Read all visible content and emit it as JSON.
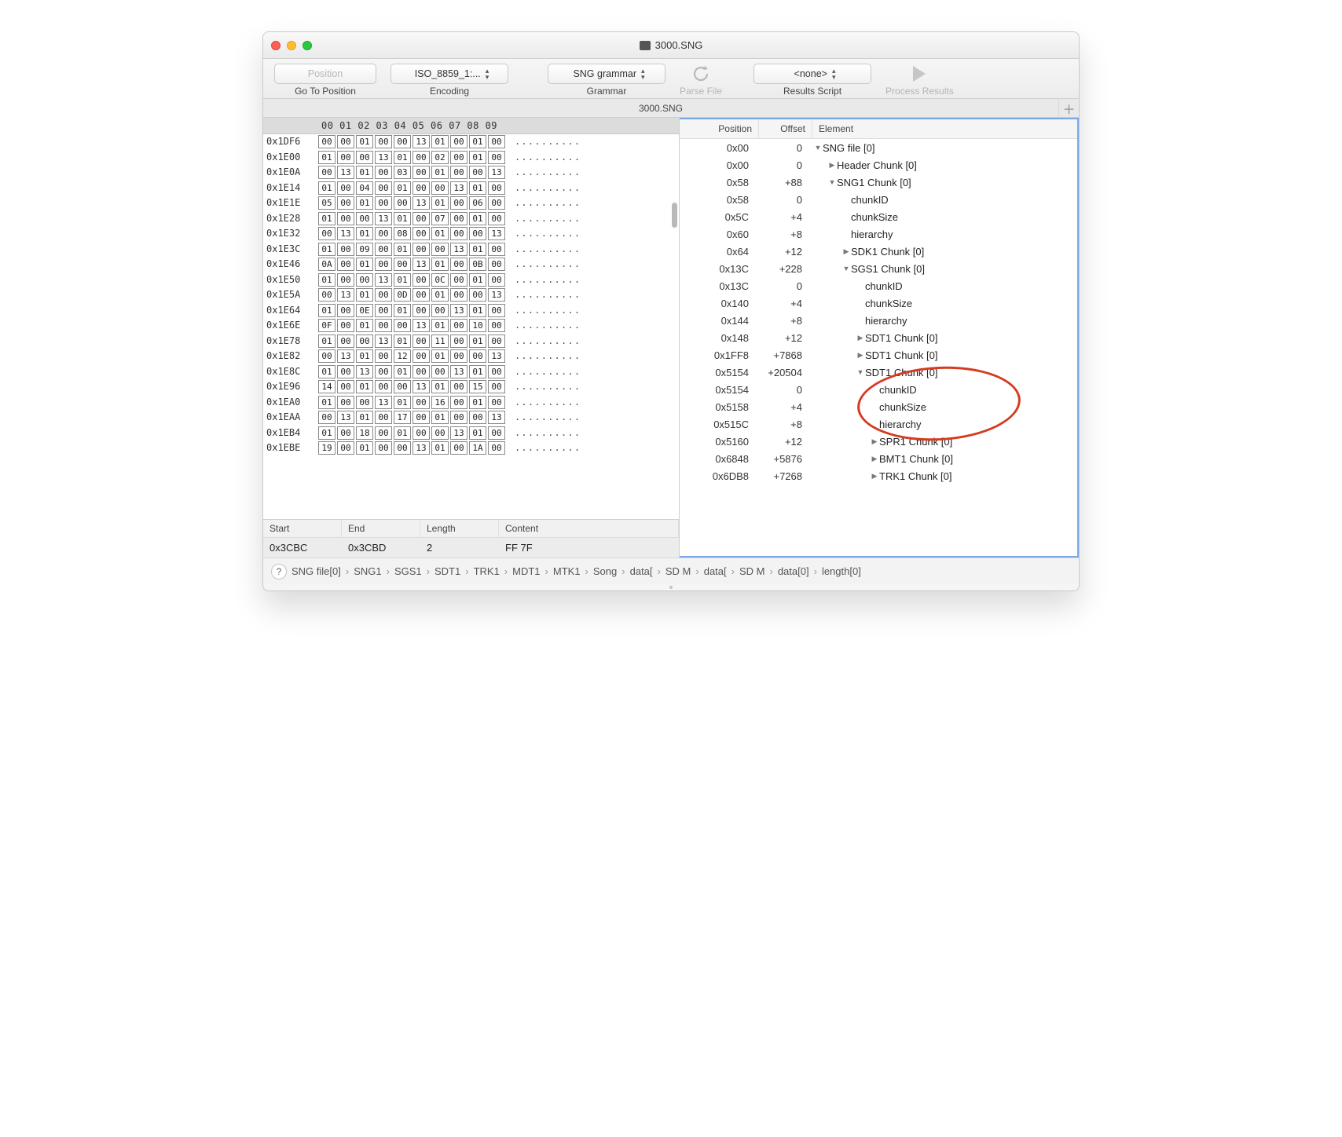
{
  "window": {
    "title": "3000.SNG"
  },
  "toolbar": {
    "position_btn": "Position",
    "go_to_label": "Go To Position",
    "encoding_value": "ISO_8859_1:...",
    "encoding_label": "Encoding",
    "grammar_value": "SNG grammar",
    "grammar_label": "Grammar",
    "parse_label": "Parse File",
    "script_value": "<none>",
    "script_label": "Results Script",
    "process_label": "Process Results"
  },
  "tab": {
    "label": "3000.SNG"
  },
  "hex": {
    "header": "00 01 02 03 04 05 06 07 08 09",
    "rows": [
      {
        "addr": "0x1DF6",
        "bytes": [
          "00",
          "00",
          "01",
          "00",
          "00",
          "13",
          "01",
          "00",
          "01",
          "00"
        ],
        "ascii": ".........."
      },
      {
        "addr": "0x1E00",
        "bytes": [
          "01",
          "00",
          "00",
          "13",
          "01",
          "00",
          "02",
          "00",
          "01",
          "00"
        ],
        "ascii": ".........."
      },
      {
        "addr": "0x1E0A",
        "bytes": [
          "00",
          "13",
          "01",
          "00",
          "03",
          "00",
          "01",
          "00",
          "00",
          "13"
        ],
        "ascii": ".........."
      },
      {
        "addr": "0x1E14",
        "bytes": [
          "01",
          "00",
          "04",
          "00",
          "01",
          "00",
          "00",
          "13",
          "01",
          "00"
        ],
        "ascii": ".........."
      },
      {
        "addr": "0x1E1E",
        "bytes": [
          "05",
          "00",
          "01",
          "00",
          "00",
          "13",
          "01",
          "00",
          "06",
          "00"
        ],
        "ascii": ".........."
      },
      {
        "addr": "0x1E28",
        "bytes": [
          "01",
          "00",
          "00",
          "13",
          "01",
          "00",
          "07",
          "00",
          "01",
          "00"
        ],
        "ascii": ".........."
      },
      {
        "addr": "0x1E32",
        "bytes": [
          "00",
          "13",
          "01",
          "00",
          "08",
          "00",
          "01",
          "00",
          "00",
          "13"
        ],
        "ascii": ".........."
      },
      {
        "addr": "0x1E3C",
        "bytes": [
          "01",
          "00",
          "09",
          "00",
          "01",
          "00",
          "00",
          "13",
          "01",
          "00"
        ],
        "ascii": ".........."
      },
      {
        "addr": "0x1E46",
        "bytes": [
          "0A",
          "00",
          "01",
          "00",
          "00",
          "13",
          "01",
          "00",
          "0B",
          "00"
        ],
        "ascii": ".........."
      },
      {
        "addr": "0x1E50",
        "bytes": [
          "01",
          "00",
          "00",
          "13",
          "01",
          "00",
          "0C",
          "00",
          "01",
          "00"
        ],
        "ascii": ".........."
      },
      {
        "addr": "0x1E5A",
        "bytes": [
          "00",
          "13",
          "01",
          "00",
          "0D",
          "00",
          "01",
          "00",
          "00",
          "13"
        ],
        "ascii": ".........."
      },
      {
        "addr": "0x1E64",
        "bytes": [
          "01",
          "00",
          "0E",
          "00",
          "01",
          "00",
          "00",
          "13",
          "01",
          "00"
        ],
        "ascii": ".........."
      },
      {
        "addr": "0x1E6E",
        "bytes": [
          "0F",
          "00",
          "01",
          "00",
          "00",
          "13",
          "01",
          "00",
          "10",
          "00"
        ],
        "ascii": ".........."
      },
      {
        "addr": "0x1E78",
        "bytes": [
          "01",
          "00",
          "00",
          "13",
          "01",
          "00",
          "11",
          "00",
          "01",
          "00"
        ],
        "ascii": ".........."
      },
      {
        "addr": "0x1E82",
        "bytes": [
          "00",
          "13",
          "01",
          "00",
          "12",
          "00",
          "01",
          "00",
          "00",
          "13"
        ],
        "ascii": ".........."
      },
      {
        "addr": "0x1E8C",
        "bytes": [
          "01",
          "00",
          "13",
          "00",
          "01",
          "00",
          "00",
          "13",
          "01",
          "00"
        ],
        "ascii": ".........."
      },
      {
        "addr": "0x1E96",
        "bytes": [
          "14",
          "00",
          "01",
          "00",
          "00",
          "13",
          "01",
          "00",
          "15",
          "00"
        ],
        "ascii": ".........."
      },
      {
        "addr": "0x1EA0",
        "bytes": [
          "01",
          "00",
          "00",
          "13",
          "01",
          "00",
          "16",
          "00",
          "01",
          "00"
        ],
        "ascii": ".........."
      },
      {
        "addr": "0x1EAA",
        "bytes": [
          "00",
          "13",
          "01",
          "00",
          "17",
          "00",
          "01",
          "00",
          "00",
          "13"
        ],
        "ascii": ".........."
      },
      {
        "addr": "0x1EB4",
        "bytes": [
          "01",
          "00",
          "18",
          "00",
          "01",
          "00",
          "00",
          "13",
          "01",
          "00"
        ],
        "ascii": ".........."
      },
      {
        "addr": "0x1EBE",
        "bytes": [
          "19",
          "00",
          "01",
          "00",
          "00",
          "13",
          "01",
          "00",
          "1A",
          "00"
        ],
        "ascii": ".........."
      }
    ]
  },
  "selection": {
    "headers": {
      "start": "Start",
      "end": "End",
      "length": "Length",
      "content": "Content"
    },
    "row": {
      "start": "0x3CBC",
      "end": "0x3CBD",
      "length": "2",
      "content": "FF 7F"
    }
  },
  "tree": {
    "headers": {
      "position": "Position",
      "offset": "Offset",
      "element": "Element"
    },
    "rows": [
      {
        "pos": "0x00",
        "off": "0",
        "indent": 0,
        "disc": "down",
        "label": "SNG file [0]"
      },
      {
        "pos": "0x00",
        "off": "0",
        "indent": 1,
        "disc": "right",
        "label": "Header Chunk [0]"
      },
      {
        "pos": "0x58",
        "off": "+88",
        "indent": 1,
        "disc": "down",
        "label": "SNG1 Chunk [0]"
      },
      {
        "pos": "0x58",
        "off": "0",
        "indent": 2,
        "disc": "",
        "label": "chunkID"
      },
      {
        "pos": "0x5C",
        "off": "+4",
        "indent": 2,
        "disc": "",
        "label": "chunkSize"
      },
      {
        "pos": "0x60",
        "off": "+8",
        "indent": 2,
        "disc": "",
        "label": "hierarchy"
      },
      {
        "pos": "0x64",
        "off": "+12",
        "indent": 2,
        "disc": "right",
        "label": "SDK1 Chunk [0]"
      },
      {
        "pos": "0x13C",
        "off": "+228",
        "indent": 2,
        "disc": "down",
        "label": "SGS1 Chunk [0]"
      },
      {
        "pos": "0x13C",
        "off": "0",
        "indent": 3,
        "disc": "",
        "label": "chunkID"
      },
      {
        "pos": "0x140",
        "off": "+4",
        "indent": 3,
        "disc": "",
        "label": "chunkSize"
      },
      {
        "pos": "0x144",
        "off": "+8",
        "indent": 3,
        "disc": "",
        "label": "hierarchy"
      },
      {
        "pos": "0x148",
        "off": "+12",
        "indent": 3,
        "disc": "right",
        "label": "SDT1 Chunk [0]"
      },
      {
        "pos": "0x1FF8",
        "off": "+7868",
        "indent": 3,
        "disc": "right",
        "label": "SDT1 Chunk [0]"
      },
      {
        "pos": "0x5154",
        "off": "+20504",
        "indent": 3,
        "disc": "down",
        "label": "SDT1 Chunk [0]"
      },
      {
        "pos": "0x5154",
        "off": "0",
        "indent": 4,
        "disc": "",
        "label": "chunkID"
      },
      {
        "pos": "0x5158",
        "off": "+4",
        "indent": 4,
        "disc": "",
        "label": "chunkSize"
      },
      {
        "pos": "0x515C",
        "off": "+8",
        "indent": 4,
        "disc": "",
        "label": "hierarchy"
      },
      {
        "pos": "0x5160",
        "off": "+12",
        "indent": 4,
        "disc": "right",
        "label": "SPR1 Chunk [0]"
      },
      {
        "pos": "0x6848",
        "off": "+5876",
        "indent": 4,
        "disc": "right",
        "label": "BMT1 Chunk [0]"
      },
      {
        "pos": "0x6DB8",
        "off": "+7268",
        "indent": 4,
        "disc": "right",
        "label": "TRK1 Chunk [0]"
      }
    ]
  },
  "breadcrumb": {
    "items": [
      "SNG file[0]",
      "SNG1",
      "SGS1",
      "SDT1",
      "TRK1",
      "MDT1",
      "MTK1",
      "Song",
      "data[",
      "SD M",
      "data[",
      "SD M",
      "data[0]",
      "length[0]"
    ]
  }
}
